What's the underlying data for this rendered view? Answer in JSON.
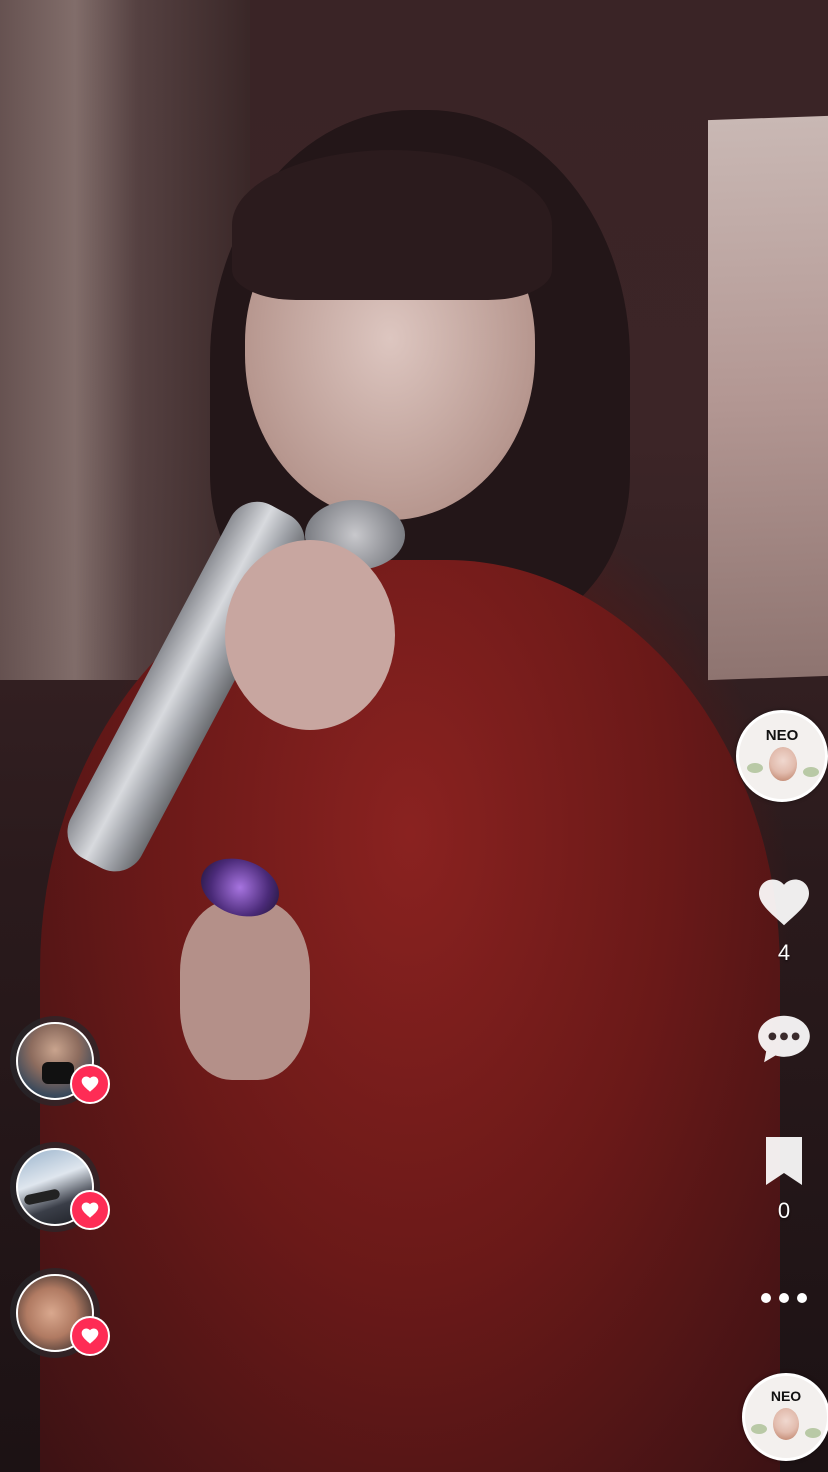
{
  "creator": {
    "name_label": "NEO"
  },
  "actions": {
    "like": {
      "icon": "heart-icon",
      "count": "4"
    },
    "comment": {
      "icon": "comment-icon"
    },
    "save": {
      "icon": "bookmark-icon",
      "count": "0"
    },
    "more": {
      "icon": "more-icon"
    }
  },
  "sound": {
    "label": "NEO"
  },
  "likers": [
    {
      "badge_icon": "heart-icon"
    },
    {
      "badge_icon": "heart-icon"
    },
    {
      "badge_icon": "heart-icon"
    }
  ],
  "colors": {
    "like_badge": "#fe2c55",
    "text": "#ffffff"
  }
}
